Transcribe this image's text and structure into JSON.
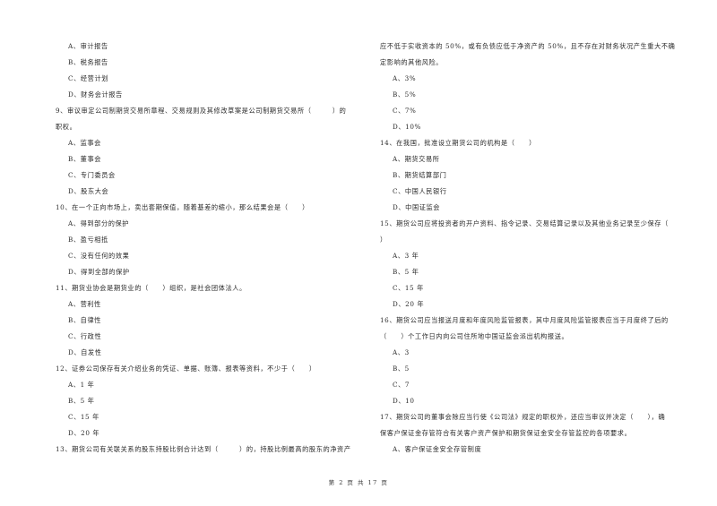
{
  "left_column": [
    {
      "type": "option",
      "text": "A、审计报告"
    },
    {
      "type": "option",
      "text": "B、税务报告"
    },
    {
      "type": "option",
      "text": "C、经营计划"
    },
    {
      "type": "option",
      "text": "D、财务会计报告"
    },
    {
      "type": "question",
      "text": "9、审议审定公司制期货交易所章程、交易规则及其修改草案是公司制期货交易所（　　　）的"
    },
    {
      "type": "question",
      "text": "职权。"
    },
    {
      "type": "option",
      "text": "A、监事会"
    },
    {
      "type": "option",
      "text": "B、董事会"
    },
    {
      "type": "option",
      "text": "C、专门委员会"
    },
    {
      "type": "option",
      "text": "D、股东大会"
    },
    {
      "type": "question",
      "text": "10、在一个正向市场上，卖出套期保值，随着基差的缩小，那么结果会是（　　）"
    },
    {
      "type": "option",
      "text": "A、得到部分的保护"
    },
    {
      "type": "option",
      "text": "B、盈亏相抵"
    },
    {
      "type": "option",
      "text": "C、没有任何的效果"
    },
    {
      "type": "option",
      "text": "D、得到全部的保护"
    },
    {
      "type": "question",
      "text": "11、期货业协会是期货业的（　　）组织，是社会团体法人。"
    },
    {
      "type": "option",
      "text": "A、营利性"
    },
    {
      "type": "option",
      "text": "B、自律性"
    },
    {
      "type": "option",
      "text": "C、行政性"
    },
    {
      "type": "option",
      "text": "D、自发性"
    },
    {
      "type": "question",
      "text": "12、证券公司保存有关介绍业务的凭证、单据、账簿、报表等资料，不少于（　　）"
    },
    {
      "type": "option",
      "text": "A、1 年"
    },
    {
      "type": "option",
      "text": "B、5 年"
    },
    {
      "type": "option",
      "text": "C、15 年"
    },
    {
      "type": "option",
      "text": "D、20 年"
    },
    {
      "type": "question",
      "text": "13、期货公司有关联关系的股东持股比例合计达到（　　　）的，持股比例最高的股东的净资产"
    }
  ],
  "right_column": [
    {
      "type": "question",
      "text": "应不低于实收资本的 50%，或有负债应低于净资产的 50%，且不存在对财务状况产生重大不确"
    },
    {
      "type": "question",
      "text": "定影响的其他风险。"
    },
    {
      "type": "option",
      "text": "A、3%"
    },
    {
      "type": "option",
      "text": "B、5%"
    },
    {
      "type": "option",
      "text": "C、7%"
    },
    {
      "type": "option",
      "text": "D、10%"
    },
    {
      "type": "question",
      "text": "14、在我国，批准设立期货公司的机构是（　　）"
    },
    {
      "type": "option",
      "text": "A、期货交易所"
    },
    {
      "type": "option",
      "text": "B、期货结算部门"
    },
    {
      "type": "option",
      "text": "C、中国人民银行"
    },
    {
      "type": "option",
      "text": "D、中国证监会"
    },
    {
      "type": "question",
      "text": "15、期货公司应将投资者的开户资料、指令记录、交易结算记录以及其他业务记录至少保存（"
    },
    {
      "type": "question",
      "text": "）"
    },
    {
      "type": "option",
      "text": "A、3 年"
    },
    {
      "type": "option",
      "text": "B、5 年"
    },
    {
      "type": "option",
      "text": "C、15 年"
    },
    {
      "type": "option",
      "text": "D、20 年"
    },
    {
      "type": "question",
      "text": "16、期货公司应当报送月度和年度风险监管报表，其中月度风险监管报表应当于月度终了后的"
    },
    {
      "type": "question",
      "text": "（　　）个工作日内向公司住所地中国证监会派出机构报送。"
    },
    {
      "type": "option",
      "text": "A、3"
    },
    {
      "type": "option",
      "text": "B、5"
    },
    {
      "type": "option",
      "text": "C、7"
    },
    {
      "type": "option",
      "text": "D、10"
    },
    {
      "type": "question",
      "text": "17、期货公司的董事会除应当行使《公司法》规定的职权外，还应当审议并决定（　　），确"
    },
    {
      "type": "question",
      "text": "保客户保证金存管符合有关客户资产保护和期货保证金安全存管监控的各项要求。"
    },
    {
      "type": "option",
      "text": "A、客户保证金安全存管制度"
    }
  ],
  "footer": {
    "page_label": "第 2 页 共 17 页"
  }
}
